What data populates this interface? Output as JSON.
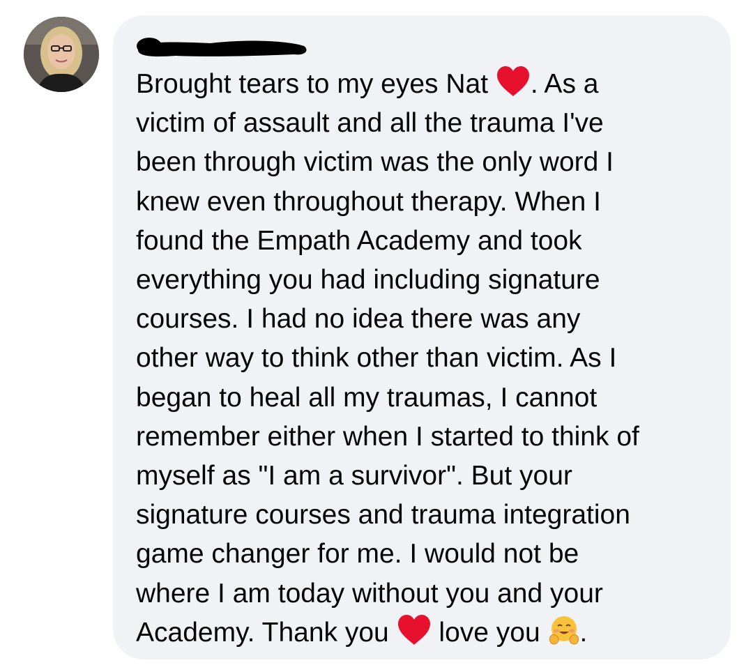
{
  "comment": {
    "author_redacted": true,
    "lines": [
      [
        "Brought tears to my eyes Nat ",
        "heart-icon",
        ". As a"
      ],
      [
        "victim of assault and all the trauma I've"
      ],
      [
        "been through victim was the only word I"
      ],
      [
        "knew even throughout therapy. When I"
      ],
      [
        "found the Empath Academy and took"
      ],
      [
        "everything you had including signature"
      ],
      [
        "courses. I had no idea there was any"
      ],
      [
        "other way to think other than victim. As I"
      ],
      [
        "began to heal all my traumas, I cannot"
      ],
      [
        "remember either when I started to think of"
      ],
      [
        "myself as \"I am a survivor\". But your"
      ],
      [
        "signature courses and trauma integration"
      ],
      [
        "game changer for me. I would not be"
      ],
      [
        "where I am today without you and your"
      ],
      [
        "Academy. Thank you ",
        "heart-icon",
        " love you ",
        "hugging-face-icon",
        "."
      ]
    ]
  },
  "colors": {
    "bubble": "#f0f2f5",
    "text": "#050505",
    "heart": "#e8112d",
    "redaction": "#000000"
  }
}
